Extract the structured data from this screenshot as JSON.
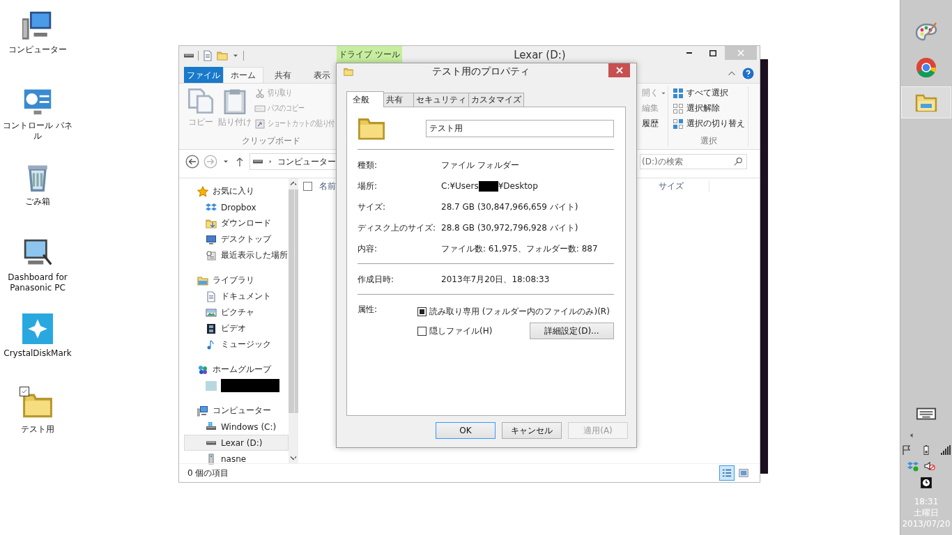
{
  "desktop_icons": [
    {
      "label": "コンピューター",
      "selected": false
    },
    {
      "label": "コントロール パネル",
      "selected": false
    },
    {
      "label": "ごみ箱",
      "selected": false
    },
    {
      "label": "Dashboard for Panasonic PC",
      "selected": false
    },
    {
      "label": "CrystalDiskMark",
      "selected": false
    },
    {
      "label": "テスト用",
      "selected": true
    }
  ],
  "explorer": {
    "title": "Lexar (D:)",
    "context_tab": "ドライブ ツール",
    "ribbon_tabs": [
      {
        "label": "ファイル",
        "kind": "file",
        "selected": false
      },
      {
        "label": "ホーム",
        "kind": "tab",
        "selected": true
      },
      {
        "label": "共有",
        "kind": "tab",
        "selected": false
      },
      {
        "label": "表示",
        "kind": "tab",
        "selected": false
      }
    ],
    "clipboard": {
      "large": [
        {
          "label": "コピー",
          "disabled": true
        },
        {
          "label": "貼り付け",
          "disabled": true
        }
      ],
      "small": [
        {
          "label": "切り取り",
          "disabled": true
        },
        {
          "label": "パスのコピー",
          "disabled": true
        },
        {
          "label": "ショートカットの貼り付",
          "disabled": true
        }
      ],
      "group": "クリップボード"
    },
    "open_items": [
      {
        "label": "開く",
        "dropdown": true,
        "disabled": true
      },
      {
        "label": "編集",
        "dropdown": false,
        "disabled": true
      },
      {
        "label": "履歴",
        "dropdown": false,
        "disabled": false
      }
    ],
    "select": {
      "items": [
        {
          "label": "すべて選択",
          "disabled": false
        },
        {
          "label": "選択解除",
          "disabled": false
        },
        {
          "label": "選択の切り替え",
          "disabled": false
        }
      ],
      "group": "選択"
    },
    "address": {
      "crumb": "コンピューター"
    },
    "search": {
      "placeholder": "(D:)の検索"
    },
    "nav": [
      {
        "label": "お気に入り",
        "selected": false,
        "children": [
          {
            "kind": "item",
            "label": "Dropbox",
            "selected": false
          },
          {
            "kind": "item",
            "label": "ダウンロード",
            "selected": false
          },
          {
            "kind": "item",
            "label": "デスクトップ",
            "selected": false
          },
          {
            "kind": "item",
            "label": "最近表示した場所",
            "selected": false
          }
        ]
      },
      {
        "label": "ライブラリ",
        "selected": false,
        "children": [
          {
            "kind": "item",
            "label": "ドキュメント",
            "selected": false
          },
          {
            "kind": "item",
            "label": "ピクチャ",
            "selected": false
          },
          {
            "kind": "item",
            "label": "ビデオ",
            "selected": false
          },
          {
            "kind": "item",
            "label": "ミュージック",
            "selected": false
          }
        ]
      },
      {
        "label": "ホームグループ",
        "selected": false,
        "children": [
          {
            "kind": "redacted",
            "selected": false
          }
        ]
      },
      {
        "label": "コンピューター",
        "selected": false,
        "children": [
          {
            "kind": "item",
            "label": "Windows (C:)",
            "selected": false
          },
          {
            "kind": "item",
            "label": "Lexar (D:)",
            "selected": true
          },
          {
            "kind": "item",
            "label": "nasne",
            "selected": false
          }
        ]
      }
    ],
    "select_all_checked": false,
    "columns": [
      "名前",
      "サイズ"
    ],
    "status": "0 個の項目",
    "views": [
      {
        "selected": true
      },
      {
        "selected": false
      }
    ]
  },
  "dialog": {
    "title": "テスト用のプロパティ",
    "tabs": [
      {
        "label": "全般",
        "selected": true
      },
      {
        "label": "共有",
        "selected": false
      },
      {
        "label": "セキュリティ",
        "selected": false
      },
      {
        "label": "カスタマイズ",
        "selected": false
      }
    ],
    "name_value": "テスト用",
    "sections": [
      [
        {
          "kind": "text",
          "label": "種類:",
          "value": "ファイル フォルダー"
        },
        {
          "kind": "redacted",
          "label": "場所:",
          "value": "C:¥Users",
          "value_after": "¥Desktop"
        },
        {
          "kind": "text",
          "label": "サイズ:",
          "value": "28.7 GB (30,847,966,659 バイト)"
        },
        {
          "kind": "text",
          "label": "ディスク上のサイズ:",
          "value": "28.8 GB (30,972,796,928 バイト)"
        },
        {
          "kind": "text",
          "label": "内容:",
          "value": "ファイル数: 61,975、フォルダー数: 887"
        }
      ],
      [
        {
          "kind": "text",
          "label": "作成日時:",
          "value": "2013年7月20日、18:08:33"
        }
      ]
    ],
    "attributes": {
      "label": "属性:",
      "checkboxes": [
        {
          "label": "読み取り専用 (フォルダー内のファイルのみ)(R)",
          "checked": false,
          "indeterminate": true
        },
        {
          "label": "隠しファイル(H)",
          "checked": false,
          "indeterminate": false
        }
      ],
      "advanced_button": "詳細設定(D)..."
    },
    "buttons": [
      {
        "label": "OK",
        "default": true,
        "disabled": false
      },
      {
        "label": "キャンセル",
        "default": false,
        "disabled": false
      },
      {
        "label": "適用(A)",
        "default": false,
        "disabled": true
      }
    ]
  },
  "taskbar": {
    "pinned": [
      {
        "selected": false
      },
      {
        "selected": false
      },
      {
        "selected": true
      }
    ],
    "time": "18:31",
    "day": "土曜日",
    "date": "2013/07/20"
  }
}
